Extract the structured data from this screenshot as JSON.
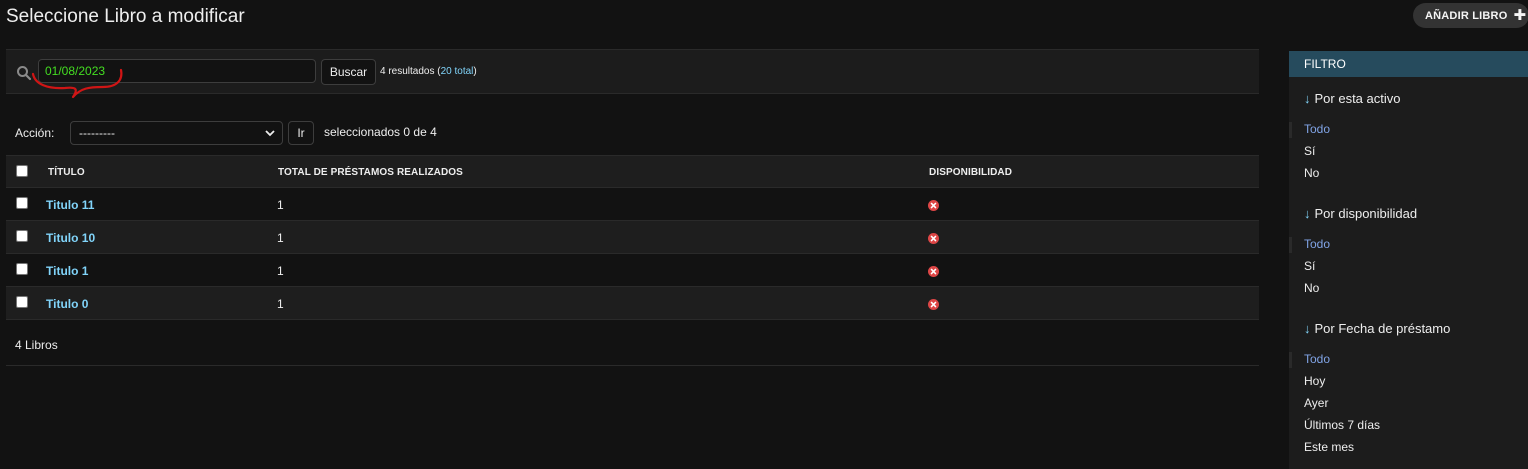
{
  "page": {
    "title": "Seleccione Libro a modificar",
    "add_button": "AÑADIR LIBRO"
  },
  "search": {
    "value": "01/08/2023",
    "button": "Buscar",
    "results_text": "4 resultados (",
    "total_link": "20 total",
    "results_close": ")",
    "annotation_color": "#d01515"
  },
  "actions": {
    "label": "Acción:",
    "selected_option": "---------",
    "go_button": "Ir",
    "selected_count": "seleccionados 0 de 4"
  },
  "table": {
    "headers": [
      "TÍTULO",
      "TOTAL DE PRÉSTAMOS REALIZADOS",
      "DISPONIBILIDAD"
    ],
    "rows": [
      {
        "title": "Titulo 11",
        "loans": "1",
        "available": false
      },
      {
        "title": "Titulo 10",
        "loans": "1",
        "available": false
      },
      {
        "title": "Titulo 1",
        "loans": "1",
        "available": false
      },
      {
        "title": "Titulo 0",
        "loans": "1",
        "available": false
      }
    ],
    "footer": "4 Libros"
  },
  "filter": {
    "header": "FILTRO",
    "sections": [
      {
        "title": "Por esta activo",
        "options": [
          "Todo",
          "Sí",
          "No"
        ],
        "selected": "Todo"
      },
      {
        "title": "Por disponibilidad",
        "options": [
          "Todo",
          "Sí",
          "No"
        ],
        "selected": "Todo"
      },
      {
        "title": "Por Fecha de préstamo",
        "options": [
          "Todo",
          "Hoy",
          "Ayer",
          "Últimos 7 días",
          "Este mes"
        ],
        "selected": "Todo"
      }
    ]
  },
  "colors": {
    "link": "#81d4fa",
    "filter_header_bg": "#264b5d",
    "unavailable_icon": "#dd4646",
    "search_text": "#44dd22"
  },
  "icons": {
    "search": "search-icon",
    "add": "plus-icon",
    "unavailable": "x-circle-icon",
    "select_arrow": "chevron-down-icon"
  }
}
